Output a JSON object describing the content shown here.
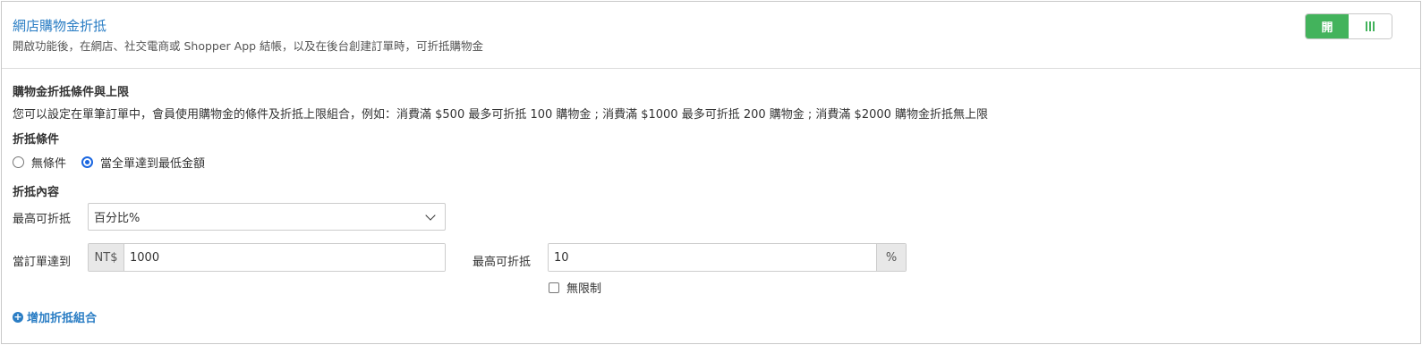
{
  "header": {
    "title": "網店購物金折抵",
    "subtitle": "開啟功能後，在網店、社交電商或 Shopper App 結帳，以及在後台創建訂單時，可折抵購物金",
    "toggle": {
      "on_label": "開",
      "state": "on",
      "accent": "#43b35c"
    }
  },
  "conditions_section": {
    "title": "購物金折抵條件與上限",
    "description": "您可以設定在單筆訂單中，會員使用購物金的條件及折抵上限組合，例如：消費滿 $500 最多可折抵 100 購物金 ; 消費滿 $1000 最多可折抵 200 購物金 ; 消費滿 $2000 購物金折抵無上限"
  },
  "deduction_condition": {
    "title": "折抵條件",
    "options": [
      {
        "label": "無條件",
        "selected": false
      },
      {
        "label": "當全單達到最低金額",
        "selected": true
      }
    ]
  },
  "deduction_content": {
    "title": "折抵內容",
    "max_label": "最高可折抵",
    "max_type_value": "百分比%",
    "order_reach_label": "當訂單達到",
    "currency_prefix": "NT$",
    "order_amount": "1000",
    "max_deduct_label": "最高可折抵",
    "max_deduct_value": "10",
    "max_deduct_suffix": "%",
    "unlimited_label": "無限制",
    "unlimited_checked": false
  },
  "add_combo_label": "增加折抵組合",
  "colors": {
    "link": "#2a7dc4",
    "radio_selected": "#1a66e0"
  }
}
